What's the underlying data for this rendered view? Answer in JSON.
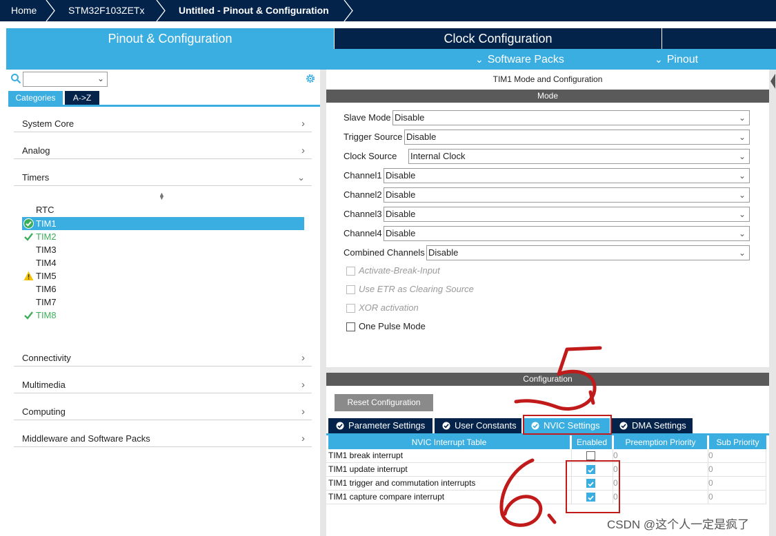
{
  "breadcrumb": {
    "items": [
      "Home",
      "STM32F103ZETx",
      "Untitled - Pinout & Configuration"
    ]
  },
  "top_tabs": {
    "pinout": "Pinout & Configuration",
    "clock": "Clock Configuration",
    "software_packs": "Software Packs",
    "pinout_menu": "Pinout"
  },
  "left": {
    "search_value": "",
    "tabs": [
      "Categories",
      "A->Z"
    ],
    "categories": [
      "System Core",
      "Analog",
      "Timers",
      "Connectivity",
      "Multimedia",
      "Computing",
      "Middleware and Software Packs"
    ],
    "timers": [
      {
        "name": "RTC",
        "status": "none"
      },
      {
        "name": "TIM1",
        "status": "selected"
      },
      {
        "name": "TIM2",
        "status": "ok"
      },
      {
        "name": "TIM3",
        "status": "none"
      },
      {
        "name": "TIM4",
        "status": "none"
      },
      {
        "name": "TIM5",
        "status": "warning"
      },
      {
        "name": "TIM6",
        "status": "none"
      },
      {
        "name": "TIM7",
        "status": "none"
      },
      {
        "name": "TIM8",
        "status": "ok"
      }
    ]
  },
  "mode": {
    "title": "TIM1 Mode and Configuration",
    "header": "Mode",
    "fields": [
      {
        "label": "Slave Mode",
        "value": "Disable"
      },
      {
        "label": "Trigger Source",
        "value": "Disable"
      },
      {
        "label": "Clock Source",
        "value": "Internal Clock"
      },
      {
        "label": "Channel1",
        "value": "Disable"
      },
      {
        "label": "Channel2",
        "value": "Disable"
      },
      {
        "label": "Channel3",
        "value": "Disable"
      },
      {
        "label": "Channel4",
        "value": "Disable"
      },
      {
        "label": "Combined Channels",
        "value": "Disable"
      }
    ],
    "checkboxes": [
      {
        "label": "Activate-Break-Input",
        "enabled": false,
        "checked": false
      },
      {
        "label": "Use ETR as Clearing Source",
        "enabled": false,
        "checked": false
      },
      {
        "label": "XOR activation",
        "enabled": false,
        "checked": false
      },
      {
        "label": "One Pulse Mode",
        "enabled": true,
        "checked": false
      }
    ]
  },
  "configuration": {
    "header": "Configuration",
    "reset_label": "Reset Configuration",
    "tabs": [
      "Parameter Settings",
      "User Constants",
      "NVIC Settings",
      "DMA Settings"
    ],
    "active_tab": "NVIC Settings",
    "table": {
      "headers": [
        "NVIC Interrupt Table",
        "Enabled",
        "Preemption Priority",
        "Sub Priority"
      ],
      "rows": [
        {
          "name": "TIM1 break interrupt",
          "enabled": false,
          "preemption": "0",
          "sub": "0"
        },
        {
          "name": "TIM1 update interrupt",
          "enabled": true,
          "preemption": "0",
          "sub": "0"
        },
        {
          "name": "TIM1 trigger and commutation interrupts",
          "enabled": true,
          "preemption": "0",
          "sub": "0"
        },
        {
          "name": "TIM1 capture compare interrupt",
          "enabled": true,
          "preemption": "0",
          "sub": "0"
        }
      ]
    }
  },
  "colors": {
    "navy": "#03234b",
    "accent": "#3aaee0",
    "annotation": "#c01a1a",
    "ok": "#3cae5a",
    "warning": "#f5c400"
  },
  "watermark": "CSDN @这个人一定是疯了"
}
